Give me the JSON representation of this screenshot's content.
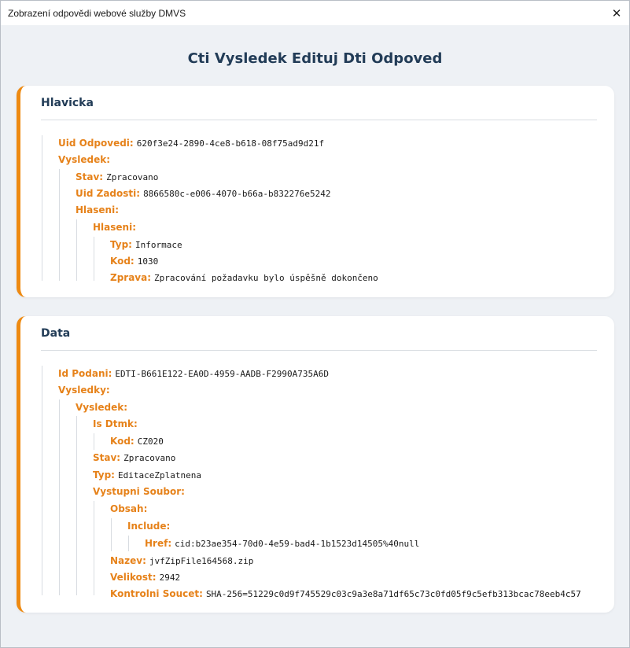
{
  "window": {
    "title": "Zobrazení odpovědi webové služby DMVS",
    "close_symbol": "✕"
  },
  "page": {
    "title": "Cti Vysledek Edituj Dti Odpoved"
  },
  "hlavicka": {
    "title": "Hlavicka",
    "uid_odpovedi_label": "Uid Odpovedi:",
    "uid_odpovedi": "620f3e24-2890-4ce8-b618-08f75ad9d21f",
    "vysledek_label": "Vysledek:",
    "stav_label": "Stav:",
    "stav": "Zpracovano",
    "uid_zadosti_label": "Uid Zadosti:",
    "uid_zadosti": "8866580c-e006-4070-b66a-b832276e5242",
    "hlaseni_outer_label": "Hlaseni:",
    "hlaseni_inner_label": "Hlaseni:",
    "typ_label": "Typ:",
    "typ": "Informace",
    "kod_label": "Kod:",
    "kod": "1030",
    "zprava_label": "Zprava:",
    "zprava": "Zpracování požadavku bylo úspěšně dokončeno"
  },
  "data": {
    "title": "Data",
    "id_podani_label": "Id Podani:",
    "id_podani": "EDTI-B661E122-EA0D-4959-AADB-F2990A735A6D",
    "vysledky_label": "Vysledky:",
    "vysledek_label": "Vysledek:",
    "is_dtmk_label": "Is Dtmk:",
    "kod_label": "Kod:",
    "kod": "CZ020",
    "stav_label": "Stav:",
    "stav": "Zpracovano",
    "typ_label": "Typ:",
    "typ": "EditaceZplatnena",
    "vystupni_soubor_label": "Vystupni Soubor:",
    "obsah_label": "Obsah:",
    "include_label": "Include:",
    "href_label": "Href:",
    "href": "cid:b23ae354-70d0-4e59-bad4-1b1523d14505%40null",
    "nazev_label": "Nazev:",
    "nazev": "jvfZipFile164568.zip",
    "velikost_label": "Velikost:",
    "velikost": "2942",
    "kontrolni_soucet_label": "Kontrolni Soucet:",
    "kontrolni_soucet": "SHA-256=51229c0d9f745529c03c9a3e8a71df65c73c0fd05f9c5efb313bcac78eeb4c57"
  },
  "colors": {
    "accent": "#ee8a12",
    "key_text": "#e6821a",
    "title_text": "#223c57",
    "background": "#eef1f5"
  }
}
